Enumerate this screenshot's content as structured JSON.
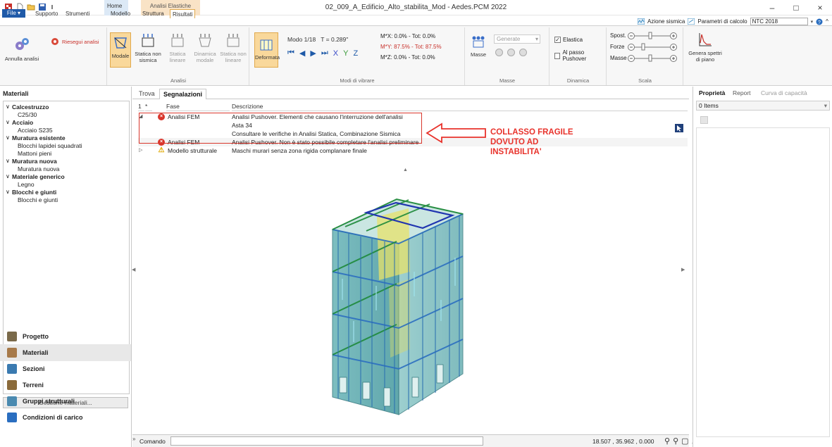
{
  "window": {
    "title": "02_009_A_Edificio_Alto_stabilita_Mod - Aedes.PCM 2022",
    "minimize": "–",
    "maximize": "□",
    "close": "×"
  },
  "context_tab": "Analisi Elastiche",
  "ribbon_tabs": {
    "file": "File ▾",
    "supporto": "Supporto",
    "strumenti": "Strumenti",
    "home": "Home",
    "modello": "Modello",
    "struttura": "Struttura",
    "risultati": "Risultati"
  },
  "top_right": {
    "azione": "Azione sismica",
    "parametri": "Parametri di calcolo",
    "norm": "NTC 2018"
  },
  "ribbon": {
    "annulla": "Annulla analisi",
    "riesegui": "Riesegui analisi",
    "modale": "Modale",
    "statica_ns": "Statica non sismica",
    "statica_l": "Statica lineare",
    "dinamica_m": "Dinamica modale",
    "statica_nl": "Statica non lineare",
    "group_analisi": "Analisi",
    "deformata": "Deformata",
    "modo": "Modo 1/18",
    "periodo": "T = 0.289\"",
    "mx": "M*X: 0.0% - Tot: 0.0%",
    "my": "M*Y: 87.5% - Tot: 87.5%",
    "mz": "M*Z: 0.0% - Tot: 0.0%",
    "ax_x": "X",
    "ax_y": "Y",
    "ax_z": "Z",
    "group_modi": "Modi di vibrare",
    "masse": "Masse",
    "generate": "Generate",
    "group_masse": "Masse",
    "elastica": "Elastica",
    "passo": "Al passo Pushover",
    "group_dinamica": "Dinamica",
    "spost": "Spost.",
    "forze": "Forze",
    "masse_s": "Masse",
    "group_scala": "Scala",
    "genera": "Genera spettri di piano"
  },
  "left": {
    "title": "Materiali",
    "tree": [
      {
        "label": "Calcestruzzo",
        "bold": true
      },
      {
        "label": "C25/30",
        "bold": false
      },
      {
        "label": "Acciaio",
        "bold": true
      },
      {
        "label": "Acciaio S235",
        "bold": false
      },
      {
        "label": "Muratura esistente",
        "bold": true
      },
      {
        "label": "Blocchi lapidei squadrati",
        "bold": false
      },
      {
        "label": "Mattoni pieni",
        "bold": false
      },
      {
        "label": "Muratura nuova",
        "bold": true
      },
      {
        "label": "Muratura nuova",
        "bold": false
      },
      {
        "label": "Materiale generico",
        "bold": true
      },
      {
        "label": "Legno",
        "bold": false
      },
      {
        "label": "Blocchi e giunti",
        "bold": true
      },
      {
        "label": "Blocchi e giunti",
        "bold": false
      }
    ],
    "gestione": "Gestione materiali...",
    "nav": [
      "Progetto",
      "Materiali",
      "Sezioni",
      "Terreni",
      "Gruppi strutturali",
      "Condizioni di carico"
    ]
  },
  "mid": {
    "tabs": [
      "Trova",
      "Segnalazioni"
    ],
    "grid_headers": [
      "1",
      "*",
      "Fase",
      "Descrizione"
    ],
    "rows": [
      {
        "fase": "Analisi FEM",
        "desc": "Analisi Pushover. Elementi che causano l'interruzione dell'analisi",
        "icon": "error"
      },
      {
        "fase": "",
        "desc": "Asta 34",
        "icon": ""
      },
      {
        "fase": "",
        "desc": "Consultare le verifiche in Analisi Statica, Combinazione Sismica",
        "icon": ""
      },
      {
        "fase": "Analisi FEM",
        "desc": "Analisi Pushover. Non è stato possibile completare l'analisi preliminare",
        "icon": "error"
      },
      {
        "fase": "Modello strutturale",
        "desc": "Maschi murari senza zona rigida complanare finale",
        "icon": "warning"
      }
    ],
    "annotation": [
      "COLLASSO FRAGILE",
      "DOVUTO AD",
      "INSTABILITA'"
    ],
    "command_label": "Comando",
    "coords": "18.507 , 35.962 , 0.000"
  },
  "right": {
    "tabs": [
      "Proprietà",
      "Report",
      "Curva di capacità"
    ],
    "items": "0 Items"
  }
}
